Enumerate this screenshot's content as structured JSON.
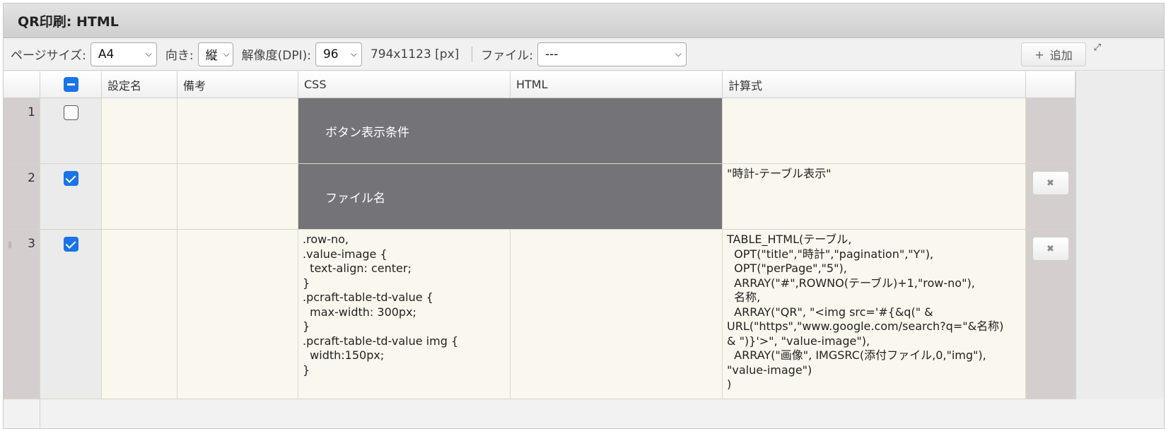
{
  "window": {
    "title": "QR印刷: HTML"
  },
  "toolbar": {
    "page_size_label": "ページサイズ:",
    "page_size_value": "A4",
    "orientation_label": "向き:",
    "orientation_value": "縦",
    "dpi_label": "解像度(DPI):",
    "dpi_value": "96",
    "dimensions": "794x1123 [px]",
    "file_label": "ファイル:",
    "file_value": "---",
    "add_label": "追加"
  },
  "table": {
    "headers": [
      "設定名",
      "備考",
      "CSS",
      "HTML",
      "計算式"
    ],
    "rows": [
      {
        "no": "1",
        "checked": false,
        "merged_text": "ボタン表示条件",
        "calc": ""
      },
      {
        "no": "2",
        "checked": true,
        "merged_text": "ファイル名",
        "calc": "\"時計-テーブル表示\""
      },
      {
        "no": "3",
        "checked": true,
        "css": ".row-no,\n.value-image {\n  text-align: center;\n}\n.pcraft-table-td-value {\n  max-width: 300px;\n}\n.pcraft-table-td-value img {\n  width:150px;\n}",
        "calc": "TABLE_HTML(テーブル,\n  OPT(\"title\",\"時計\",\"pagination\",\"Y\"),\n  OPT(\"perPage\",\"5\"),\n  ARRAY(\"#\",ROWNO(テーブル)+1,\"row-no\"),\n  名称,\n  ARRAY(\"QR\", \"<img src='#{&q(\" &\nURL(\"https\",\"www.google.com/search?q=\"&名称)\n& \")}'>\", \"value-image\"),\n  ARRAY(\"画像\", IMGSRC(添付ファイル,0,\"img\"),\n\"value-image\")\n)"
      }
    ]
  },
  "icons": {
    "add": "plus-icon",
    "delete": "close-icon",
    "expand": "expand-icon",
    "drag": "drag-handle-icon"
  },
  "colors": {
    "accent": "#1a73e8",
    "merged_cell_bg": "#747478",
    "cell_bg": "#faf8ee",
    "row_no_bg": "#d5cece"
  }
}
